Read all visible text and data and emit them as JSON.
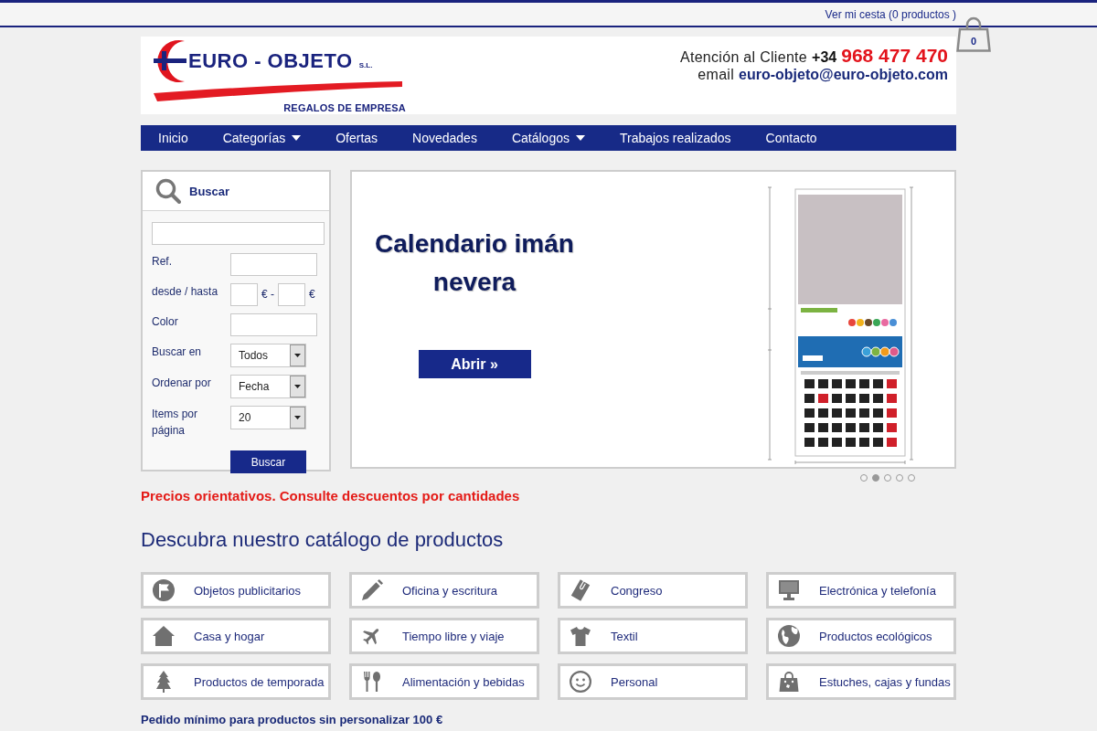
{
  "top_bar": {
    "cart_link": "Ver mi cesta (0 productos )",
    "cart_count": "0"
  },
  "header": {
    "logo": {
      "name": "EURO - OBJETO",
      "suffix": "S.L.",
      "tagline": "REGALOS DE EMPRESA"
    },
    "contact": {
      "label": "Atención al Cliente",
      "prefix": "+34",
      "phone": "968 477 470",
      "email_label": "email",
      "email": "euro-objeto@euro-objeto.com"
    }
  },
  "nav": [
    {
      "label": "Inicio",
      "dropdown": false
    },
    {
      "label": "Categorías",
      "dropdown": true
    },
    {
      "label": "Ofertas",
      "dropdown": false
    },
    {
      "label": "Novedades",
      "dropdown": false
    },
    {
      "label": "Catálogos",
      "dropdown": true
    },
    {
      "label": "Trabajos realizados",
      "dropdown": false
    },
    {
      "label": "Contacto",
      "dropdown": false
    }
  ],
  "search": {
    "title": "Buscar",
    "fields": [
      {
        "kind": "search"
      },
      {
        "kind": "text",
        "label": "Ref."
      },
      {
        "kind": "range",
        "label": "desde / hasta",
        "from_unit": "€ -",
        "to_unit": "€"
      },
      {
        "kind": "text",
        "label": "Color"
      },
      {
        "kind": "select",
        "label": "Buscar en",
        "value": "Todos"
      },
      {
        "kind": "select",
        "label": "Ordenar por",
        "value": "Fecha"
      },
      {
        "kind": "select",
        "label": "Items por página",
        "value": "20"
      }
    ],
    "button": "Buscar"
  },
  "banner": {
    "title": "Calendario imán nevera",
    "button": "Abrir »",
    "pager": [
      {
        "selected": false
      },
      {
        "selected": true
      },
      {
        "selected": false
      },
      {
        "selected": false
      },
      {
        "selected": false
      }
    ]
  },
  "notice": "Precios orientativos. Consulte descuentos por cantidades",
  "catalog": {
    "heading": "Descubra nuestro catálogo de productos",
    "categories": [
      "Objetos publicitarios",
      "Oficina y escritura",
      "Congreso",
      "Electrónica y telefonía",
      "Casa y hogar",
      "Tiempo libre y viaje",
      "Textil",
      "Productos ecológicos",
      "Productos de temporada",
      "Alimentación y bebidas",
      "Personal",
      "Estuches, cajas y fundas"
    ]
  },
  "footer_note": "Pedido mínimo para productos sin personalizar 100 €"
}
